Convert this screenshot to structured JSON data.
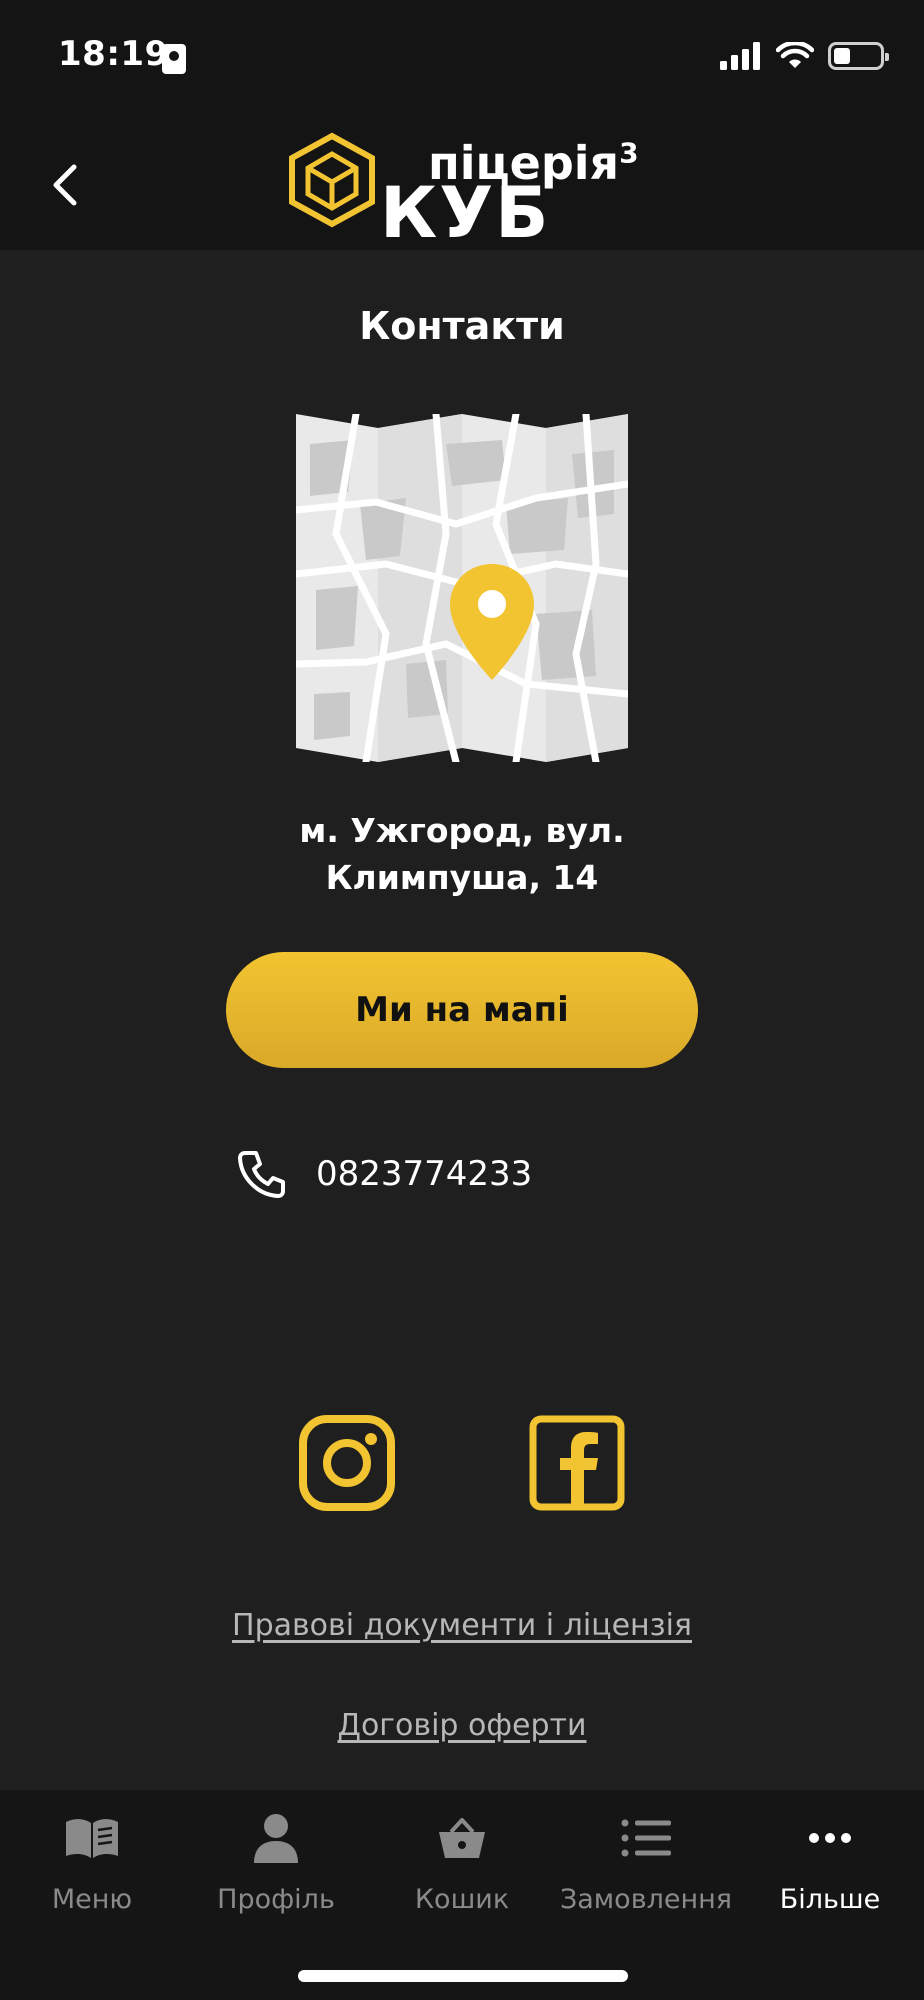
{
  "status_bar": {
    "time": "18:19"
  },
  "header": {
    "logo_sub": "піцерія",
    "logo_sup": "3",
    "logo_main": "КУБ"
  },
  "page": {
    "title": "Контакти",
    "address_line1": "м. Ужгород, вул.",
    "address_line2": "Климпуша, 14",
    "map_button": "Ми на мапі",
    "phone": "0823774233",
    "links": {
      "legal": "Правові документи і ліцензія",
      "offer": "Договір оферти"
    }
  },
  "tabbar": {
    "items": [
      {
        "label": "Меню",
        "icon": "book-icon"
      },
      {
        "label": "Профіль",
        "icon": "person-icon"
      },
      {
        "label": "Кошик",
        "icon": "basket-icon"
      },
      {
        "label": "Замовлення",
        "icon": "list-icon"
      },
      {
        "label": "Більше",
        "icon": "more-icon"
      }
    ],
    "active_index": 4
  },
  "colors": {
    "accent": "#f2c431",
    "background": "#1f1f1f",
    "header_bg": "#141414"
  }
}
